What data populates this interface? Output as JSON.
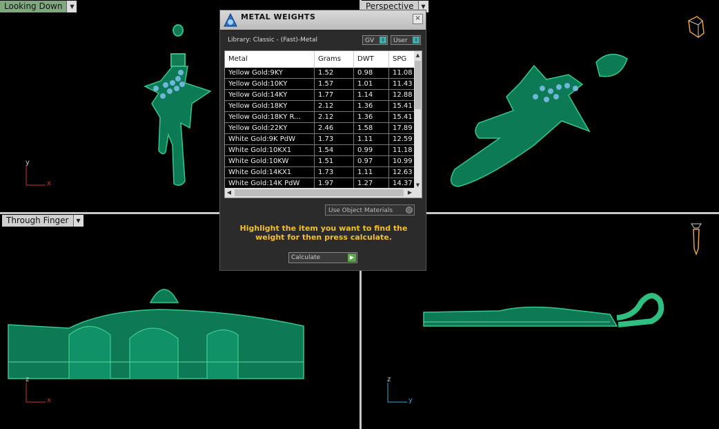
{
  "viewports": {
    "top_left": {
      "label": "Looking Down",
      "axis_v": "y",
      "axis_h": "x"
    },
    "top_right": {
      "label": "Perspective"
    },
    "bottom_left": {
      "label": "Through Finger",
      "axis_v": "z",
      "axis_h": "x"
    },
    "bottom_right": {
      "axis_v": "z",
      "axis_h": "y"
    }
  },
  "dialog": {
    "title": "METAL WEIGHTS",
    "close": "×",
    "library_label": "Library: Classic - (Fast)-Metal",
    "toggle_gv": "GV",
    "toggle_user": "User",
    "columns": [
      "Metal",
      "Grams",
      "DWT",
      "SPG"
    ],
    "rows": [
      [
        "Yellow Gold:9KY",
        "1.52",
        "0.98",
        "11.08"
      ],
      [
        "Yellow Gold:10KY",
        "1.57",
        "1.01",
        "11.43"
      ],
      [
        "Yellow Gold:14KY",
        "1.77",
        "1.14",
        "12.88"
      ],
      [
        "Yellow Gold:18KY",
        "2.12",
        "1.36",
        "15.41"
      ],
      [
        "Yellow Gold:18KY R...",
        "2.12",
        "1.36",
        "15.41"
      ],
      [
        "Yellow Gold:22KY",
        "2.46",
        "1.58",
        "17.89"
      ],
      [
        "White Gold:9K PdW",
        "1.73",
        "1.11",
        "12.59"
      ],
      [
        "White Gold:10KX1",
        "1.54",
        "0.99",
        "11.18"
      ],
      [
        "White Gold:10KW",
        "1.51",
        "0.97",
        "10.99"
      ],
      [
        "White Gold:14KX1",
        "1.73",
        "1.11",
        "12.63"
      ],
      [
        "White Gold:14K PdW",
        "1.97",
        "1.27",
        "14.37"
      ]
    ],
    "use_object_materials": "Use Object Materials",
    "hint": "Highlight the item you want to find the weight for then press calculate.",
    "calculate": "Calculate"
  }
}
